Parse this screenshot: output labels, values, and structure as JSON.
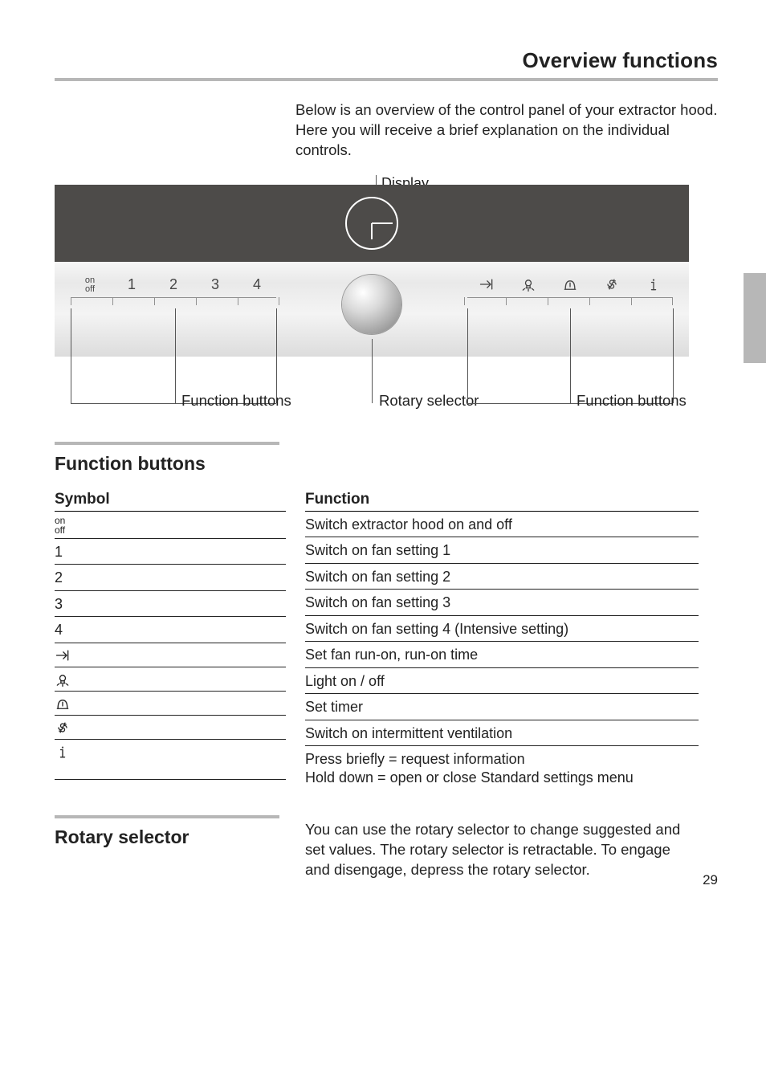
{
  "header": {
    "title": "Overview functions"
  },
  "intro": "Below is an overview of the control panel of your extractor hood. Here you will receive a brief explanation on the individual controls.",
  "diagram": {
    "display_label": "Display",
    "left_buttons": {
      "onoff_top": "on",
      "onoff_bottom": "off",
      "b1": "1",
      "b2": "2",
      "b3": "3",
      "b4": "4"
    },
    "right_icons": [
      "runon-icon",
      "light-icon",
      "timer-icon",
      "intermittent-icon",
      "info-icon"
    ],
    "callout_function_buttons": "Function buttons",
    "callout_rotary": "Rotary selector"
  },
  "function_buttons": {
    "heading": "Function buttons",
    "col_symbol": "Symbol",
    "col_function": "Function",
    "rows": [
      {
        "symbol_type": "onoff",
        "function": "Switch extractor hood on and off"
      },
      {
        "symbol_type": "text",
        "symbol": "1",
        "function": "Switch on fan setting 1"
      },
      {
        "symbol_type": "text",
        "symbol": "2",
        "function": "Switch on fan setting 2"
      },
      {
        "symbol_type": "text",
        "symbol": "3",
        "function": "Switch on fan setting 3"
      },
      {
        "symbol_type": "text",
        "symbol": "4",
        "function": "Switch on fan setting 4 (Intensive setting)"
      },
      {
        "symbol_type": "icon",
        "icon": "runon-icon",
        "function": "Set fan run-on, run-on time"
      },
      {
        "symbol_type": "icon",
        "icon": "light-icon",
        "function": "Light on / off"
      },
      {
        "symbol_type": "icon",
        "icon": "timer-icon",
        "function": "Set timer"
      },
      {
        "symbol_type": "icon",
        "icon": "intermittent-icon",
        "function": "Switch on intermittent ventilation"
      },
      {
        "symbol_type": "icon",
        "icon": "info-icon",
        "function": "Press briefly = request information\nHold down = open or close Standard settings menu"
      }
    ]
  },
  "rotary": {
    "heading": "Rotary selector",
    "text": "You can use the rotary selector to change suggested and set values. The rotary selector is retractable. To engage and disengage, depress the rotary selector."
  },
  "page_number": "29"
}
